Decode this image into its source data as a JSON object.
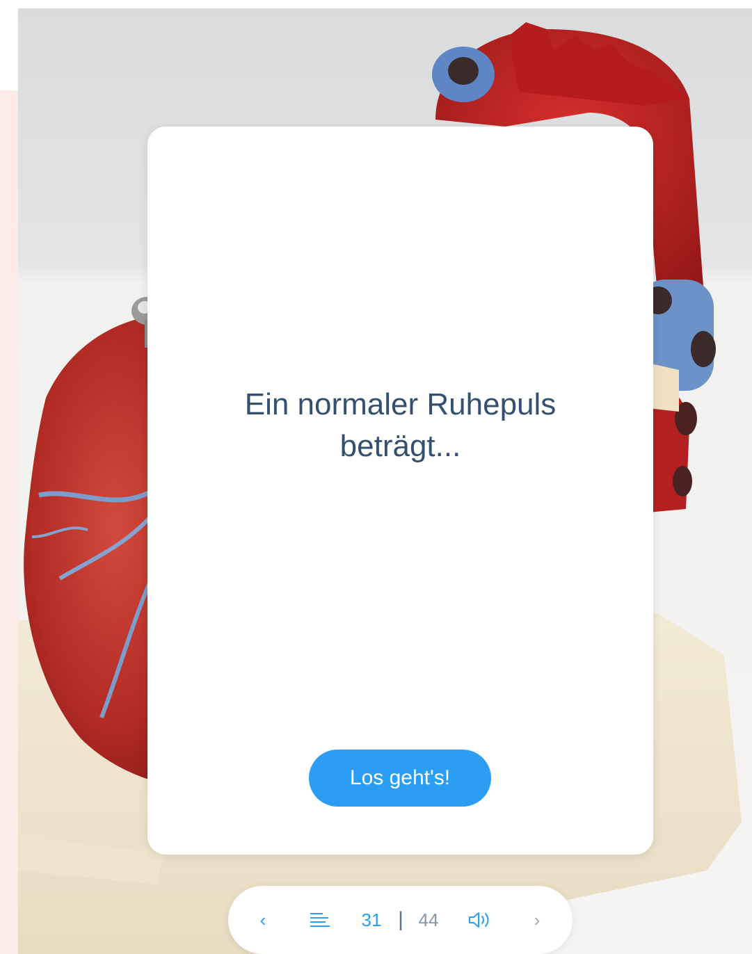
{
  "card": {
    "question": "Ein normaler Ruhepuls beträgt...",
    "start_label": "Los geht's!"
  },
  "nav": {
    "prev_icon": "chevron-left-icon",
    "prev_glyph": "‹",
    "list_icon": "list-icon",
    "current": "31",
    "separator": "|",
    "total": "44",
    "sound_icon": "speaker-icon",
    "next_icon": "chevron-right-icon",
    "next_glyph": "›"
  },
  "colors": {
    "accent": "#2b9ef3",
    "question_text": "#34506e",
    "left_strip": "#fbeae8"
  }
}
